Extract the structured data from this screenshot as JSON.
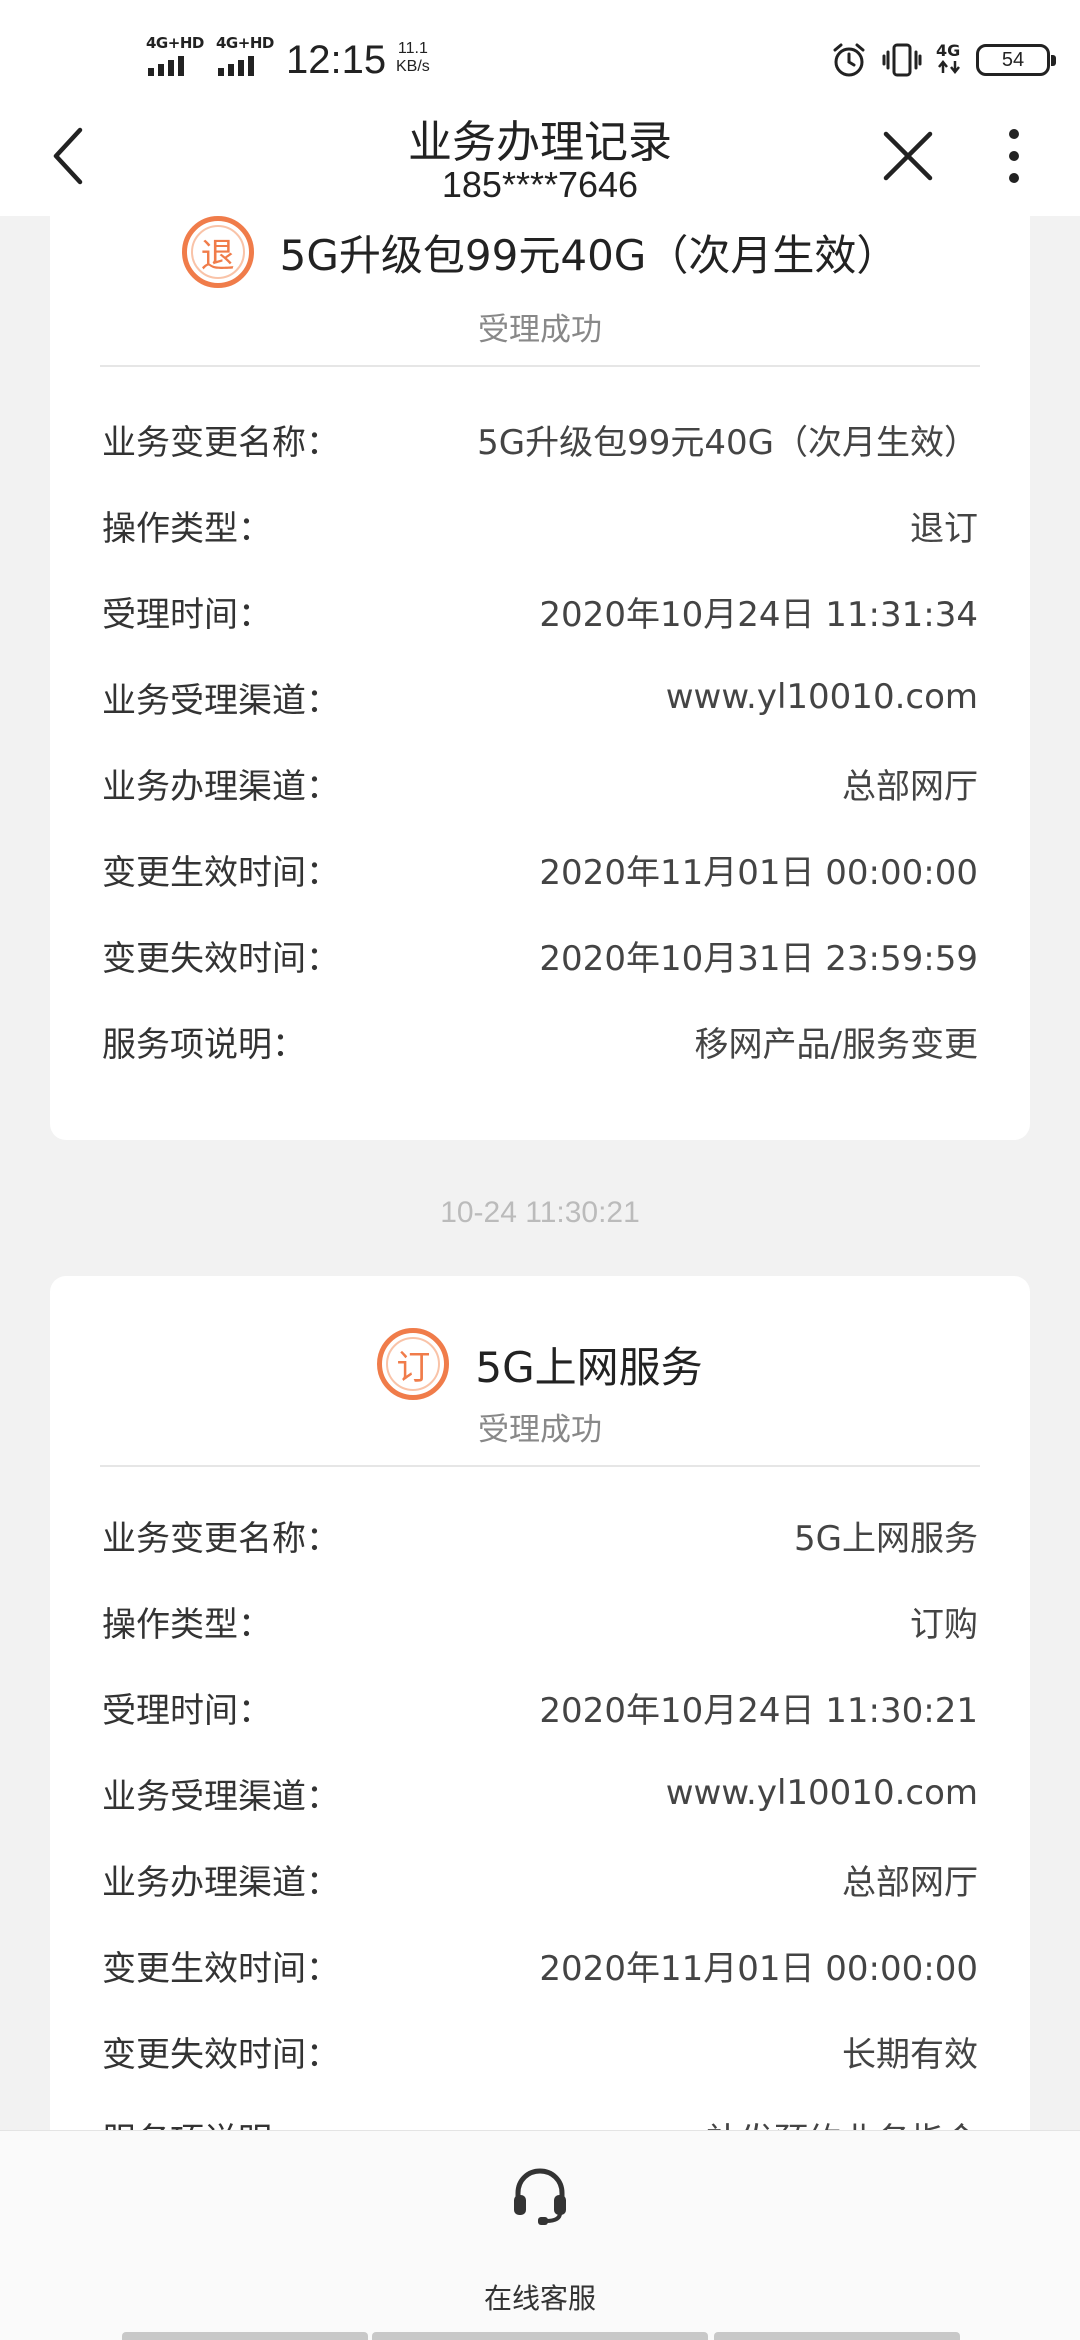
{
  "status_bar": {
    "signal1": "4G+HD",
    "signal2": "4G+HD",
    "time": "12:15",
    "speed_value": "11.1",
    "speed_unit": "KB/s",
    "network": "4G",
    "battery": "54",
    "icons": [
      "alarm-icon",
      "vibrate-icon",
      "network-4g-icon",
      "battery-icon"
    ]
  },
  "nav": {
    "title": "业务办理记录",
    "subtitle": "185****7646",
    "icons": [
      "back-arrow-icon",
      "close-icon",
      "more-icon"
    ]
  },
  "records": [
    {
      "badge": "退",
      "title": "5G升级包99元40G（次月生效）",
      "status": "受理成功",
      "rows": [
        {
          "label": "业务变更名称：",
          "value": "5G升级包99元40G（次月生效）"
        },
        {
          "label": "操作类型：",
          "value": "退订"
        },
        {
          "label": "受理时间：",
          "value": "2020年10月24日 11:31:34"
        },
        {
          "label": "业务受理渠道：",
          "value": "www.yl10010.com"
        },
        {
          "label": "业务办理渠道：",
          "value": "总部网厅"
        },
        {
          "label": "变更生效时间：",
          "value": "2020年11月01日 00:00:00"
        },
        {
          "label": "变更失效时间：",
          "value": "2020年10月31日 23:59:59"
        },
        {
          "label": "服务项说明：",
          "value": "移网产品/服务变更"
        }
      ]
    },
    {
      "time_separator": "10-24 11:30:21",
      "badge": "订",
      "title": "5G上网服务",
      "status": "受理成功",
      "rows": [
        {
          "label": "业务变更名称：",
          "value": "5G上网服务"
        },
        {
          "label": "操作类型：",
          "value": "订购"
        },
        {
          "label": "受理时间：",
          "value": "2020年10月24日 11:30:21"
        },
        {
          "label": "业务受理渠道：",
          "value": "www.yl10010.com"
        },
        {
          "label": "业务办理渠道：",
          "value": "总部网厅"
        },
        {
          "label": "变更生效时间：",
          "value": "2020年11月01日 00:00:00"
        },
        {
          "label": "变更失效时间：",
          "value": "长期有效"
        },
        {
          "label": "服务项说明：",
          "value": "补发预约业务指令"
        }
      ]
    }
  ],
  "bottom_bar": {
    "service_label": "在线客服",
    "service_icon": "headset-icon"
  },
  "colors": {
    "accent": "#f07c4a",
    "background": "#f2f2f2",
    "card": "#ffffff",
    "muted_text": "#888888"
  }
}
